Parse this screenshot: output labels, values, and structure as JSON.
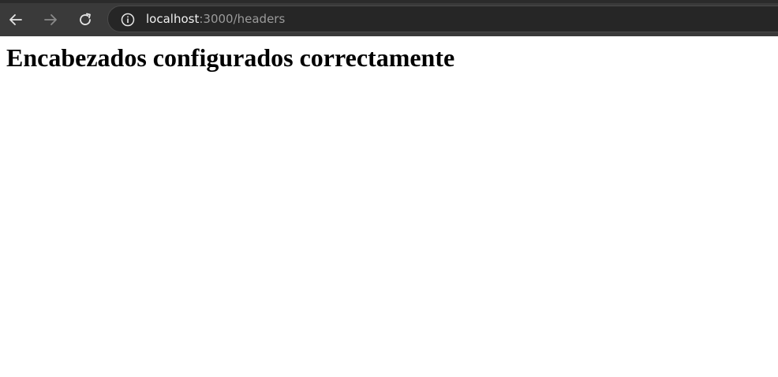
{
  "browser": {
    "url_host": "localhost",
    "url_path": ":3000/headers",
    "icons": {
      "back": "arrow-left-icon",
      "forward": "arrow-right-icon",
      "reload": "reload-icon",
      "site_info": "info-icon"
    },
    "colors": {
      "toolbar": "#3a3a3a",
      "address_bar": "#262626",
      "url_host": "#f0f0f0",
      "url_path": "#9a9a9a"
    }
  },
  "page": {
    "heading": "Encabezados configurados correctamente"
  }
}
